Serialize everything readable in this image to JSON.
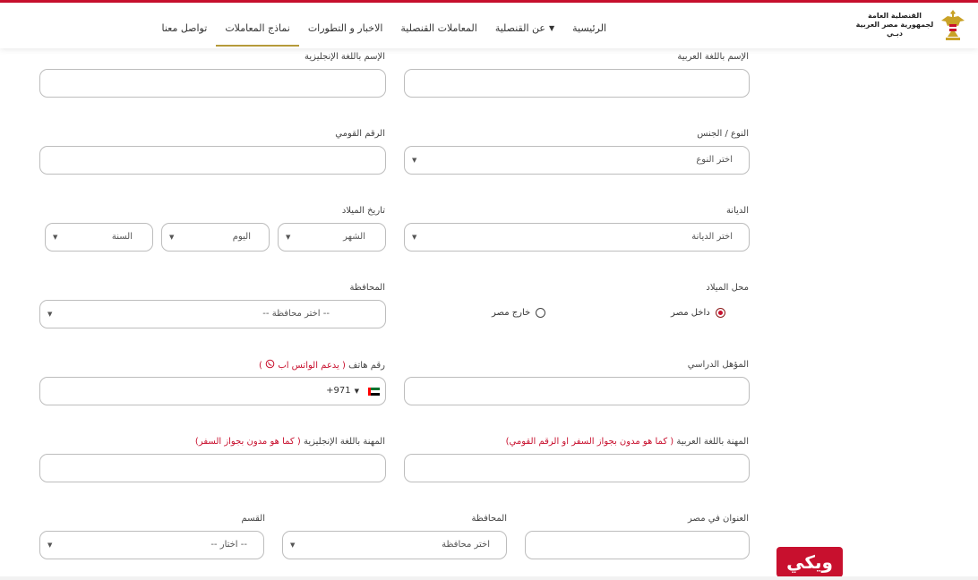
{
  "header": {
    "logo_line1": "القنصلية العامة",
    "logo_line2": "لجمهورية مصر العربية",
    "logo_line3": "دبـي",
    "nav": [
      {
        "label": "الرئيسية"
      },
      {
        "label": "عن القنصلية"
      },
      {
        "label": "المعاملات القنصلية"
      },
      {
        "label": "الاخبار و التطورات"
      },
      {
        "label": "نماذج المعاملات"
      },
      {
        "label": "تواصل معنا"
      }
    ]
  },
  "form": {
    "name_ar_label": "الإسم باللغة العربية",
    "name_en_label": "الإسم باللغة الإنجليزية",
    "gender_label": "النوع / الجنس",
    "gender_value": "اختر النوع",
    "national_id_label": "الرقم القومي",
    "religion_label": "الديانة",
    "religion_value": "اختر الديانة",
    "birthdate_label": "تاريخ الميلاد",
    "month_value": "الشهر",
    "day_value": "اليوم",
    "year_value": "السنة",
    "birthplace_label": "محل الميلاد",
    "birthplace_inside": "داخل مصر",
    "birthplace_outside": "خارج مصر",
    "governorate_label": "المحافظة",
    "governorate_value": "-- اختر محافظة --",
    "education_label": "المؤهل الدراسي",
    "phone_label": "رقم هاتف",
    "phone_hint": "( يدعم الواتس اب",
    "phone_hint_end": ")",
    "phone_code": "+971",
    "job_ar_label": "المهنة باللغة العربية",
    "job_ar_hint": "( كما هو مدون بجواز السفر او الرقم القومي)",
    "job_en_label": "المهنة باللغة الإنجليزية",
    "job_en_hint": "( كما هو مدون بجواز السفر)",
    "address_label": "العنوان في مصر",
    "address_gov_label": "المحافظة",
    "address_gov_value": "اختر محافظة",
    "district_label": "القسم",
    "district_value": "-- اختار --"
  },
  "badge": {
    "text": "ويكي"
  },
  "colors": {
    "accent": "#c8102e",
    "nav_active_underline": "#b59a3a"
  }
}
